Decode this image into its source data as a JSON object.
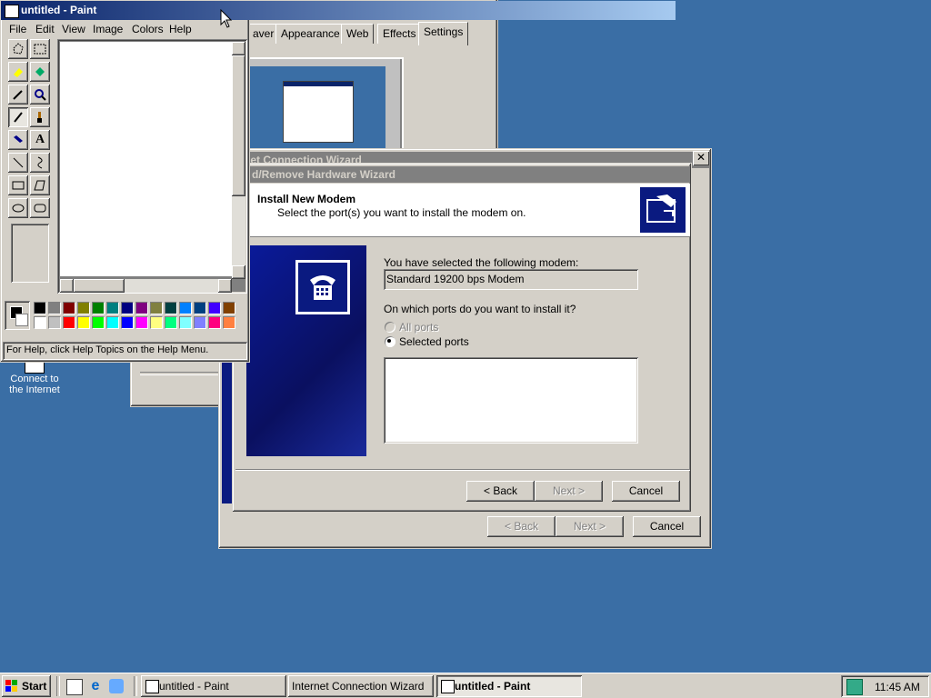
{
  "display_props": {
    "tabs": [
      "aver",
      "Appearance",
      "Web",
      "Effects",
      "Settings"
    ]
  },
  "desktop": {
    "icon_label_line1": "Connect to",
    "icon_label_line2": "the Internet"
  },
  "icw_back": {
    "title": "net Connection Wizard",
    "back": "< Back",
    "next": "Next >",
    "cancel": "Cancel"
  },
  "modem_wizard": {
    "title": "d/Remove Hardware Wizard",
    "close_glyph": "✕",
    "header_title": "Install New Modem",
    "header_subtitle": "Select the port(s) you want to install the modem on.",
    "selected_label": "You have selected the following modem:",
    "modem_name": "Standard 19200 bps Modem",
    "ports_question": "On which ports do you want to install it?",
    "radio_all": "All ports",
    "radio_selected": "Selected ports",
    "back": "< Back",
    "next": "Next >",
    "cancel": "Cancel"
  },
  "paint": {
    "title": "untitled - Paint",
    "menu": [
      "File",
      "Edit",
      "View",
      "Image",
      "Colors",
      "Help"
    ],
    "status": "For Help, click Help Topics on the Help Menu.",
    "palette_top": [
      "#000000",
      "#808080",
      "#800000",
      "#808000",
      "#008000",
      "#008080",
      "#000080",
      "#800080",
      "#808040",
      "#004040",
      "#0080ff",
      "#004080",
      "#4000ff",
      "#804000"
    ],
    "palette_bottom": [
      "#ffffff",
      "#c0c0c0",
      "#ff0000",
      "#ffff00",
      "#00ff00",
      "#00ffff",
      "#0000ff",
      "#ff00ff",
      "#ffff80",
      "#00ff80",
      "#80ffff",
      "#8080ff",
      "#ff0080",
      "#ff8040"
    ]
  },
  "taskbar": {
    "start": "Start",
    "buttons": [
      "untitled - Paint",
      "Internet Connection Wizard",
      "untitled - Paint"
    ],
    "clock": "11:45 AM"
  }
}
